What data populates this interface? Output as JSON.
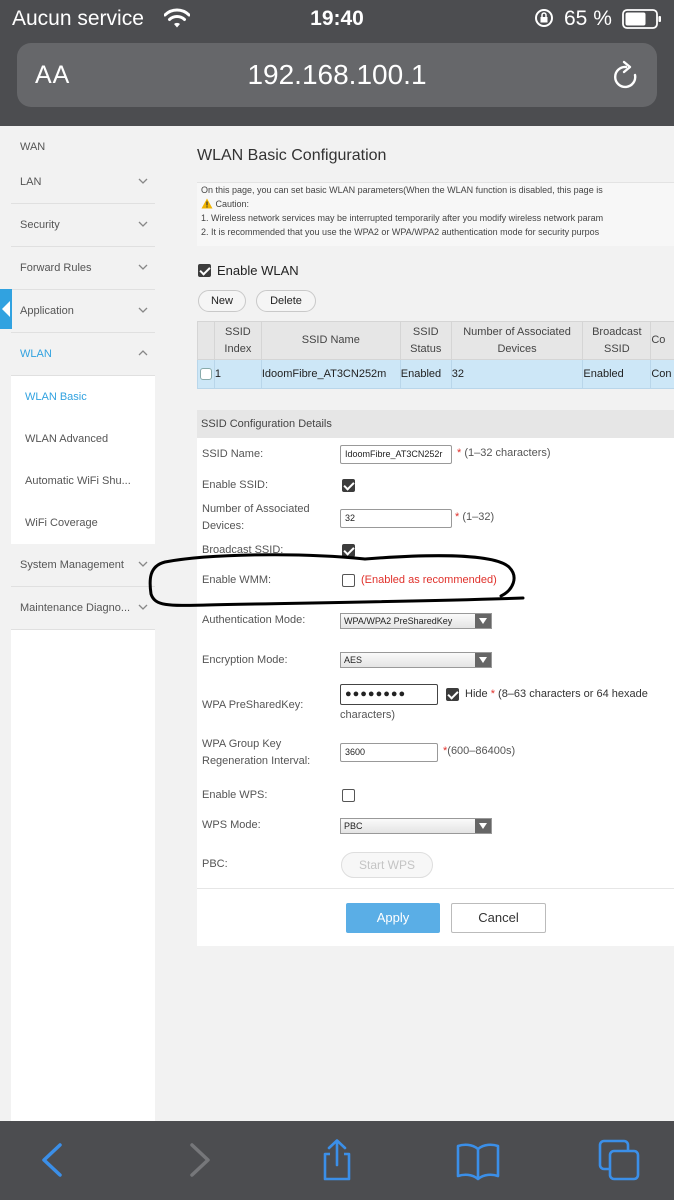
{
  "status_bar": {
    "carrier": "Aucun service",
    "time": "19:40",
    "battery_percent": "65 %",
    "icons": [
      "wifi-icon",
      "orientation-lock-icon",
      "battery-icon"
    ]
  },
  "browser": {
    "text_size_button": "AA",
    "url": "192.168.100.1",
    "reload_icon": "reload-icon"
  },
  "sidebar": {
    "items": [
      {
        "label": "WAN"
      },
      {
        "label": "LAN"
      },
      {
        "label": "Security"
      },
      {
        "label": "Forward Rules"
      },
      {
        "label": "Application"
      },
      {
        "label": "WLAN"
      }
    ],
    "sub_items": [
      {
        "label": "WLAN Basic"
      },
      {
        "label": "WLAN Advanced"
      },
      {
        "label": "Automatic WiFi Shu..."
      },
      {
        "label": "WiFi Coverage"
      }
    ],
    "bottom_items": [
      {
        "label": "System Management"
      },
      {
        "label": "Maintenance Diagno..."
      }
    ]
  },
  "main": {
    "title": "WLAN Basic Configuration",
    "intro_line1": "On this page, you can set basic WLAN parameters(When the WLAN function is disabled, this page is",
    "caution_label": "Caution:",
    "intro_line2": "1. Wireless network services may be interrupted temporarily after you modify wireless network param",
    "intro_line3": "2. It is recommended that you use the WPA2 or WPA/WPA2 authentication mode for security purpos",
    "enable_wlan_label": "Enable WLAN",
    "new_button": "New",
    "delete_button": "Delete",
    "table": {
      "headers": [
        "SSID Index",
        "SSID Name",
        "SSID Status",
        "Number of Associated Devices",
        "Broadcast SSID",
        "Co"
      ],
      "rows": [
        [
          "1",
          "IdoomFibre_AT3CN252m",
          "Enabled",
          "32",
          "Enabled",
          "Con"
        ]
      ]
    },
    "details": {
      "header": "SSID Configuration Details",
      "ssid_name_label": "SSID Name:",
      "ssid_name_value": "IdoomFibre_AT3CN252r",
      "ssid_name_hint": "(1–32 characters)",
      "enable_ssid_label": "Enable SSID:",
      "assoc_label": "Number of Associated Devices:",
      "assoc_value": "32",
      "assoc_hint": "(1–32)",
      "broadcast_label": "Broadcast SSID:",
      "wmm_label": "Enable WMM:",
      "wmm_hint": "(Enabled as recommended)",
      "auth_label": "Authentication Mode:",
      "auth_value": "WPA/WPA2 PreSharedKey",
      "enc_label": "Encryption Mode:",
      "enc_value": "AES",
      "psk_label": "WPA PreSharedKey:",
      "psk_value": "●●●●●●●●",
      "hide_label": "Hide",
      "psk_hint": "(8–63 characters or 64 hexade",
      "psk_hint2": "characters)",
      "group_key_label": "WPA Group Key Regeneration Interval:",
      "group_key_value": "3600",
      "group_key_hint": "(600–86400s)",
      "wps_label": "Enable WPS:",
      "wps_mode_label": "WPS Mode:",
      "wps_mode_value": "PBC",
      "pbc_label": "PBC:",
      "start_wps_button": "Start WPS",
      "required_star": "*",
      "apply_button": "Apply",
      "cancel_button": "Cancel"
    },
    "checkbox_states": {
      "enable_wlan": true,
      "row_select": false,
      "enable_ssid": true,
      "broadcast_ssid": true,
      "enable_wmm": false,
      "hide": true,
      "enable_wps": false
    }
  },
  "toolbar": {
    "icons": [
      "back-icon",
      "forward-icon",
      "share-icon",
      "bookmarks-icon",
      "tabs-icon"
    ]
  }
}
